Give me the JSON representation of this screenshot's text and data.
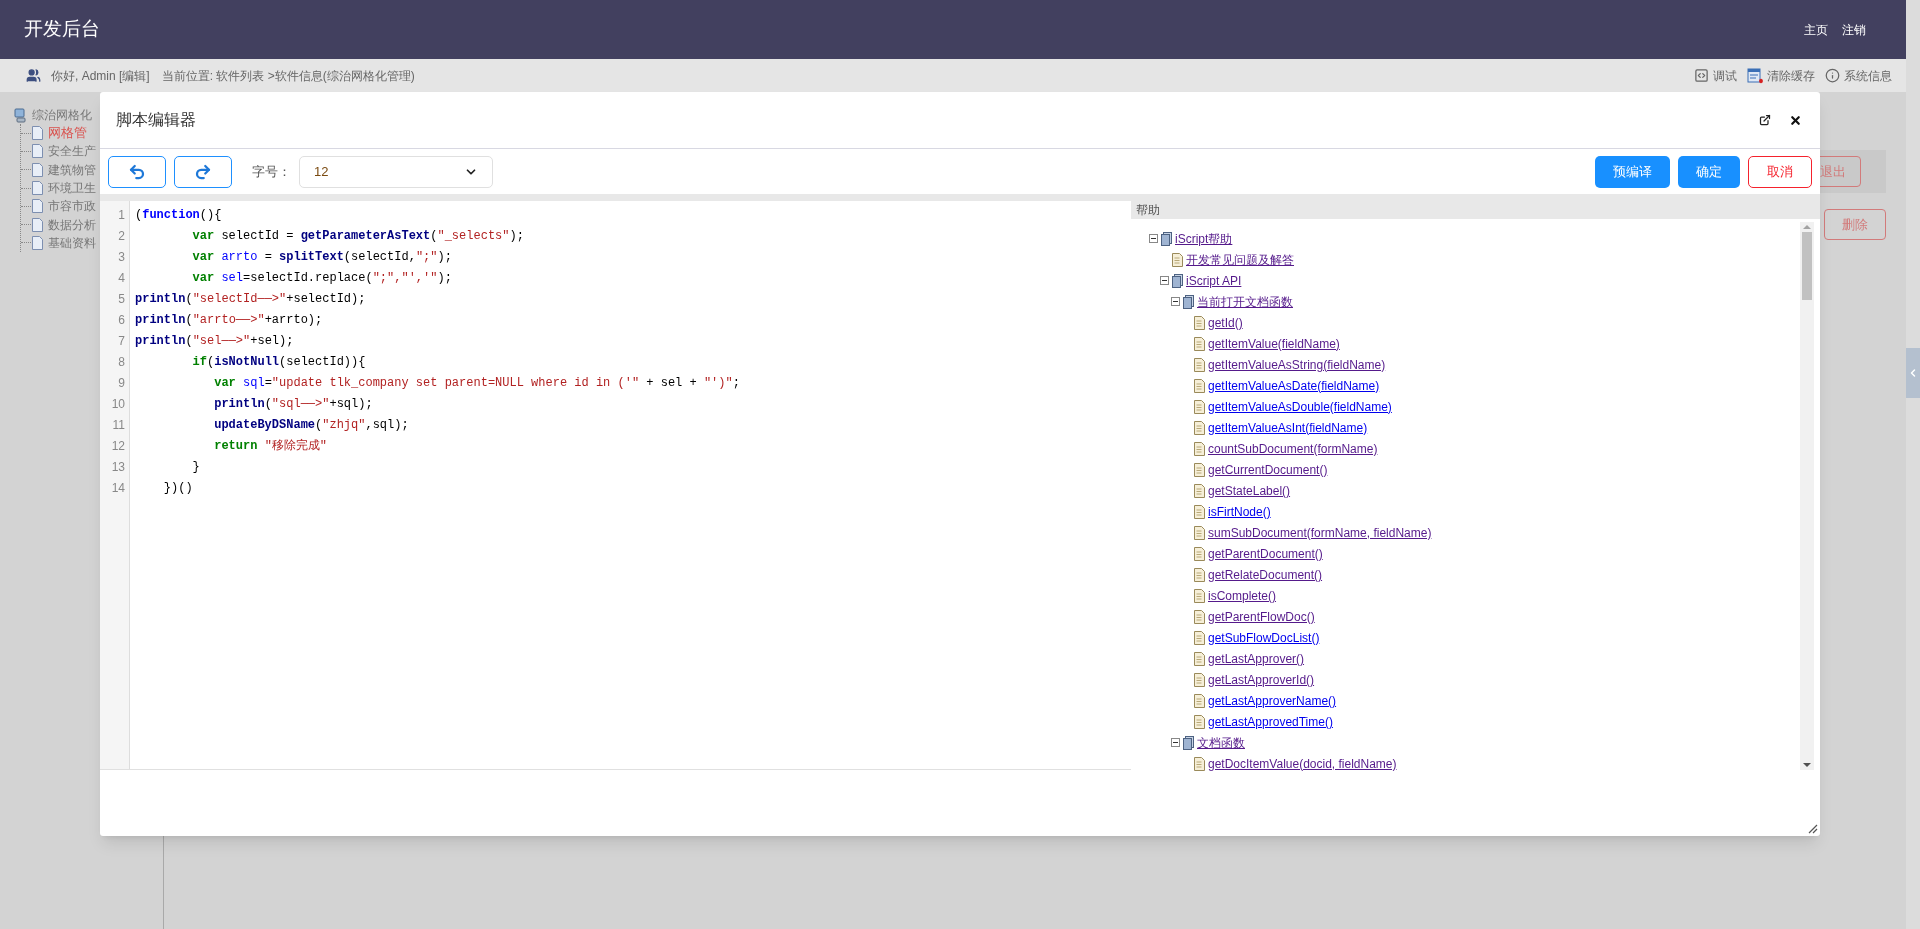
{
  "header": {
    "title": "开发后台",
    "links": [
      "主页",
      "注销"
    ]
  },
  "breadcrumb": {
    "greeting": "你好, Admin [编辑]",
    "location": "当前位置: 软件列表 >软件信息(综治网格化管理)",
    "tools": [
      {
        "label": "调试",
        "kind": "debug"
      },
      {
        "label": "清除缓存",
        "kind": "clear-cache"
      },
      {
        "label": "系统信息",
        "kind": "info"
      }
    ]
  },
  "sidebar": {
    "tree": {
      "label": "综治网格化",
      "children": [
        {
          "label": "网格管",
          "selected": true
        },
        {
          "label": "安全生产",
          "selected": false
        },
        {
          "label": "建筑物管",
          "selected": false
        },
        {
          "label": "环境卫生",
          "selected": false
        },
        {
          "label": "市容市政",
          "selected": false
        },
        {
          "label": "数据分析",
          "selected": false
        },
        {
          "label": "基础资料",
          "selected": false
        }
      ]
    }
  },
  "page_buttons": [
    "退出",
    "删除"
  ],
  "dialog": {
    "title": "脚本编辑器",
    "toolbar": {
      "font_size_label": "字号：",
      "font_size": "12"
    },
    "actions": [
      {
        "label": "预编译",
        "kind": "primary"
      },
      {
        "label": "确定",
        "kind": "primary"
      },
      {
        "label": "取消",
        "kind": "danger"
      }
    ],
    "code_lines": [
      {
        "number": "1",
        "tokens": [
          {
            "kind": "plain",
            "text": "("
          },
          {
            "kind": "decl",
            "text": "function"
          },
          {
            "kind": "plain",
            "text": "(){"
          }
        ]
      },
      {
        "number": "2",
        "tokens": [
          {
            "kind": "keyword",
            "text": "        var"
          },
          {
            "kind": "plain",
            "text": " selectId = "
          },
          {
            "kind": "call",
            "text": "getParameterAsText"
          },
          {
            "kind": "plain",
            "text": "("
          },
          {
            "kind": "string",
            "text": "\"_selects\""
          },
          {
            "kind": "plain",
            "text": ");"
          }
        ]
      },
      {
        "number": "3",
        "tokens": [
          {
            "kind": "keyword",
            "text": "        var "
          },
          {
            "kind": "ident",
            "text": "arrto"
          },
          {
            "kind": "plain",
            "text": " = "
          },
          {
            "kind": "call",
            "text": "splitText"
          },
          {
            "kind": "plain",
            "text": "(selectId,"
          },
          {
            "kind": "string",
            "text": "\";\""
          },
          {
            "kind": "plain",
            "text": ");"
          }
        ]
      },
      {
        "number": "4",
        "tokens": [
          {
            "kind": "keyword",
            "text": "        var "
          },
          {
            "kind": "ident",
            "text": "sel"
          },
          {
            "kind": "plain",
            "text": "=selectId.replace("
          },
          {
            "kind": "string",
            "text": "\";\",\"','\""
          },
          {
            "kind": "plain",
            "text": ");"
          }
        ]
      },
      {
        "number": "5",
        "tokens": [
          {
            "kind": "call",
            "text": "println"
          },
          {
            "kind": "plain",
            "text": "("
          },
          {
            "kind": "string",
            "text": "\"selectId——>\""
          },
          {
            "kind": "plain",
            "text": "+selectId);"
          }
        ]
      },
      {
        "number": "6",
        "tokens": [
          {
            "kind": "call",
            "text": "println"
          },
          {
            "kind": "plain",
            "text": "("
          },
          {
            "kind": "string",
            "text": "\"arrto——>\""
          },
          {
            "kind": "plain",
            "text": "+arrto);"
          }
        ]
      },
      {
        "number": "7",
        "tokens": [
          {
            "kind": "call",
            "text": "println"
          },
          {
            "kind": "plain",
            "text": "("
          },
          {
            "kind": "string",
            "text": "\"sel——>\""
          },
          {
            "kind": "plain",
            "text": "+sel);"
          }
        ]
      },
      {
        "number": "8",
        "tokens": [
          {
            "kind": "keyword",
            "text": "        if"
          },
          {
            "kind": "plain",
            "text": "("
          },
          {
            "kind": "call",
            "text": "isNotNull"
          },
          {
            "kind": "plain",
            "text": "(selectId)){"
          }
        ]
      },
      {
        "number": "9",
        "tokens": [
          {
            "kind": "keyword",
            "text": "           var "
          },
          {
            "kind": "ident",
            "text": "sql"
          },
          {
            "kind": "plain",
            "text": "="
          },
          {
            "kind": "string",
            "text": "\"update tlk_company set parent=NULL where id in ('\""
          },
          {
            "kind": "plain",
            "text": " + sel + "
          },
          {
            "kind": "string",
            "text": "\"')\""
          },
          {
            "kind": "plain",
            "text": ";"
          }
        ]
      },
      {
        "number": "10",
        "tokens": [
          {
            "kind": "call",
            "text": "           println"
          },
          {
            "kind": "plain",
            "text": "("
          },
          {
            "kind": "string",
            "text": "\"sql——>\""
          },
          {
            "kind": "plain",
            "text": "+sql);"
          }
        ]
      },
      {
        "number": "11",
        "tokens": [
          {
            "kind": "call",
            "text": "           updateByDSName"
          },
          {
            "kind": "plain",
            "text": "("
          },
          {
            "kind": "string",
            "text": "\"zhjq\""
          },
          {
            "kind": "plain",
            "text": ",sql);"
          }
        ]
      },
      {
        "number": "12",
        "tokens": [
          {
            "kind": "keyword",
            "text": "           return "
          },
          {
            "kind": "string",
            "text": "\"移除完成\""
          }
        ]
      },
      {
        "number": "13",
        "tokens": [
          {
            "kind": "plain",
            "text": "        }"
          }
        ]
      },
      {
        "number": "14",
        "tokens": [
          {
            "kind": "plain",
            "text": "    })()"
          }
        ]
      }
    ],
    "help": {
      "title": "帮助",
      "tree": [
        {
          "label": "iScript帮助",
          "kind": "book",
          "expanded": true,
          "visited": true,
          "children": [
            {
              "label": "开发常见问题及解答",
              "kind": "page",
              "visited": true
            },
            {
              "label": "iScript API",
              "kind": "book",
              "expanded": true,
              "visited": true,
              "children": [
                {
                  "label": "当前打开文档函数",
                  "kind": "book",
                  "expanded": true,
                  "visited": true,
                  "children": [
                    {
                      "label": "getId()",
                      "kind": "page",
                      "visited": true
                    },
                    {
                      "label": "getItemValue(fieldName)",
                      "kind": "page",
                      "visited": true
                    },
                    {
                      "label": "getItemValueAsString(fieldName)",
                      "kind": "page",
                      "visited": true
                    },
                    {
                      "label": "getItemValueAsDate(fieldName)",
                      "kind": "page",
                      "visited": false
                    },
                    {
                      "label": "getItemValueAsDouble(fieldName)",
                      "kind": "page",
                      "visited": false
                    },
                    {
                      "label": "getItemValueAsInt(fieldName)",
                      "kind": "page",
                      "visited": false
                    },
                    {
                      "label": "countSubDocument(formName)",
                      "kind": "page",
                      "visited": true
                    },
                    {
                      "label": "getCurrentDocument()",
                      "kind": "page",
                      "visited": true
                    },
                    {
                      "label": "getStateLabel()",
                      "kind": "page",
                      "visited": true
                    },
                    {
                      "label": "isFirtNode()",
                      "kind": "page",
                      "visited": false
                    },
                    {
                      "label": "sumSubDocument(formName, fieldName)",
                      "kind": "page",
                      "visited": true
                    },
                    {
                      "label": "getParentDocument()",
                      "kind": "page",
                      "visited": true
                    },
                    {
                      "label": "getRelateDocument()",
                      "kind": "page",
                      "visited": true
                    },
                    {
                      "label": "isComplete()",
                      "kind": "page",
                      "visited": true
                    },
                    {
                      "label": "getParentFlowDoc()",
                      "kind": "page",
                      "visited": true
                    },
                    {
                      "label": "getSubFlowDocList()",
                      "kind": "page",
                      "visited": false
                    },
                    {
                      "label": "getLastApprover()",
                      "kind": "page",
                      "visited": true
                    },
                    {
                      "label": "getLastApproverId()",
                      "kind": "page",
                      "visited": true
                    },
                    {
                      "label": "getLastApproverName()",
                      "kind": "page",
                      "visited": false
                    },
                    {
                      "label": "getLastApprovedTime()",
                      "kind": "page",
                      "visited": false
                    }
                  ]
                },
                {
                  "label": "文档函数",
                  "kind": "book",
                  "expanded": true,
                  "visited": true,
                  "children": [
                    {
                      "label": "getDocItemValue(docid, fieldName)",
                      "kind": "page",
                      "visited": true
                    }
                  ]
                }
              ]
            }
          ]
        }
      ]
    }
  }
}
